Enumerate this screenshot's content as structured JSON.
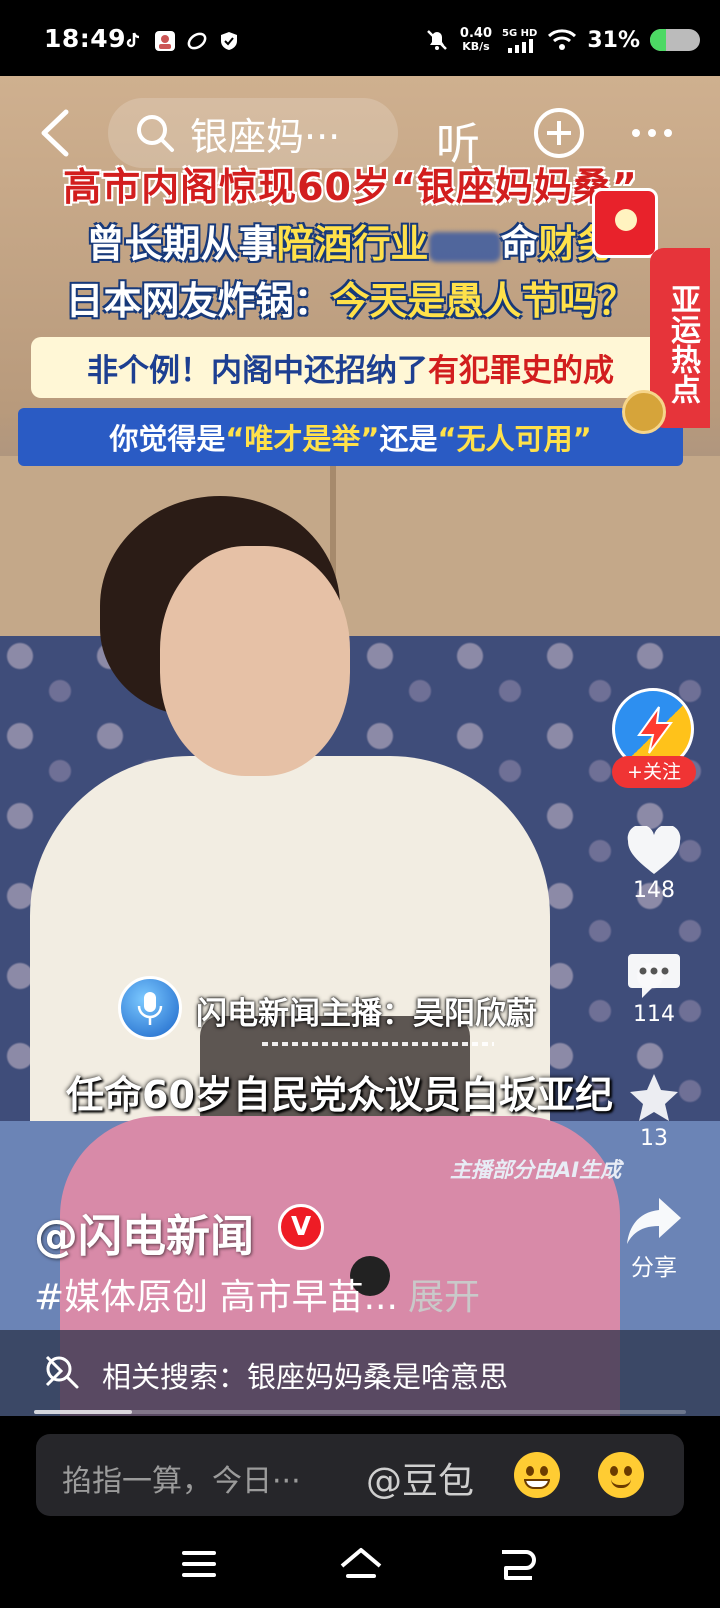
{
  "status_bar": {
    "time": "18:49",
    "net_speed_value": "0.40",
    "net_speed_unit": "KB/s",
    "network": "5G HD",
    "battery_percent": "31%",
    "battery_level": 0.31,
    "icons": [
      "tiktok-icon",
      "profile-app-icon",
      "sync-app-icon",
      "shield-icon",
      "mute-bell-icon",
      "signal-icon",
      "wifi-icon",
      "battery-icon"
    ]
  },
  "top_nav": {
    "search_text": "银座妈···",
    "listen_label": "听"
  },
  "video": {
    "headline_line1": "高市内阁惊现60岁“银座妈妈桑”",
    "headline_line2_a": "曾长期从事",
    "headline_line2_b": "陪酒行业",
    "headline_line2_c": "命",
    "headline_line2_d": "财务",
    "headline_line3_a": "日本网友炸锅：",
    "headline_line3_b": "今天是愚人节吗？",
    "headline_line4_a": "非个例！内阁中还招纳了",
    "headline_line4_b": "有犯罪史的成",
    "headline_line5_a": "你觉得是",
    "headline_line5_b": "“唯才是举”",
    "headline_line5_c": "还是",
    "headline_line5_d": "“无人可用”",
    "side_tab_label": "亚运热点",
    "anchor_label": "闪电新闻主播：吴阳欣蔚",
    "subtitle": "任命60岁自民党众议员白坂亚纪",
    "ai_note": "主播部分由AI生成"
  },
  "actions": {
    "follow_label": "+关注",
    "likes": "148",
    "comments": "114",
    "favorites": "13",
    "share_label": "分享"
  },
  "caption": {
    "author": "@闪电新闻",
    "verified_badge": "V",
    "description": "#媒体原创 高市早苗...",
    "expand_label": "展开"
  },
  "related_search": {
    "text": "相关搜索：银座妈妈桑是啥意思"
  },
  "playback_progress": 0.15,
  "comment_bar": {
    "placeholder": "掐指一算，今日···",
    "mention": "@豆包"
  },
  "colors": {
    "accent_red": "#ee1c25",
    "follow_red": "#f03434",
    "headline_red": "#d21e1e",
    "headline_blue": "#17397a",
    "highlight_yellow": "#ffe14a"
  }
}
